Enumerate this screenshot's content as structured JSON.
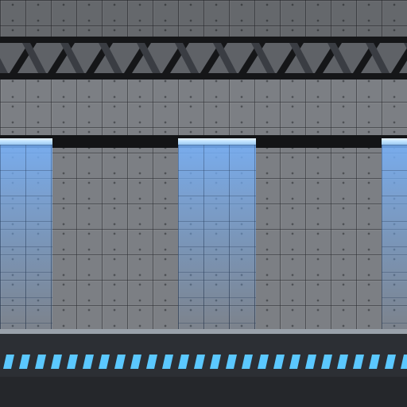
{
  "scene": {
    "type": "side-scrolling platformer background",
    "theme": "industrial sci-fi corridor",
    "elements": {
      "wall": "riveted-metal-panel-wall",
      "girder": "steel-truss-girder",
      "lights": "ceiling-light-beams",
      "floor": "dark-floor-with-light-strip"
    }
  },
  "colors": {
    "wall": "#7c7f84",
    "girder_dark": "#151618",
    "girder_brace": "#3a3d43",
    "rail": "#131416",
    "lamp": "#e9f6ff",
    "beam": "#78b4ff",
    "floor": "#2c2f34",
    "floor_stripe": "#5bc8ff"
  },
  "lights": [
    {
      "name": "light-left"
    },
    {
      "name": "light-center"
    },
    {
      "name": "light-right"
    }
  ]
}
